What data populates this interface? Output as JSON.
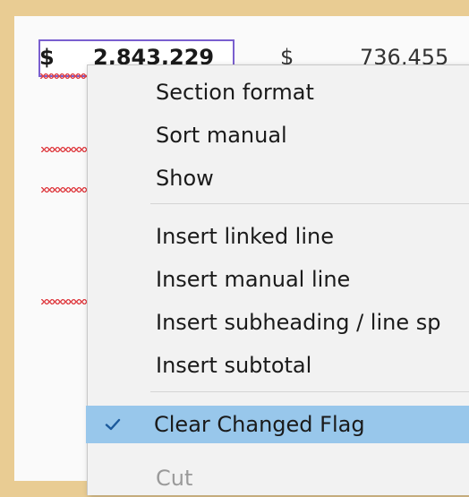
{
  "cells": {
    "selected_currency": "$",
    "selected_amount": "2,843,229",
    "next_currency": "$",
    "next_amount": "736,455"
  },
  "context_menu": {
    "items": [
      {
        "label": "Section format"
      },
      {
        "label": "Sort manual"
      },
      {
        "label": "Show"
      },
      {
        "label": "Insert linked line"
      },
      {
        "label": "Insert manual line"
      },
      {
        "label": "Insert subheading / line sp"
      },
      {
        "label": "Insert subtotal"
      },
      {
        "label": "Clear Changed Flag",
        "checked": true
      },
      {
        "label": "Cut"
      }
    ]
  },
  "icons": {
    "check": "checkmark-icon"
  },
  "colors": {
    "highlight": "#98c7eb",
    "check": "#1c5a9c",
    "spellcheck_squiggle": "#e0454a",
    "cell_selection_border": "#7a5fcf"
  }
}
